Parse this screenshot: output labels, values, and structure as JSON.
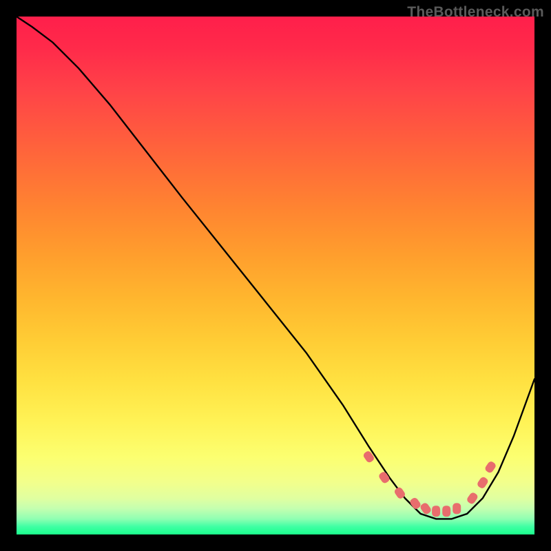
{
  "watermark": "TheBottleneck.com",
  "chart_data": {
    "type": "line",
    "title": "",
    "xlabel": "",
    "ylabel": "",
    "xlim": [
      0,
      100
    ],
    "ylim": [
      0,
      100
    ],
    "series": [
      {
        "name": "bottleneck-curve",
        "x": [
          0,
          3,
          7,
          12,
          18,
          25,
          32,
          40,
          48,
          56,
          63,
          68,
          72,
          75,
          78,
          81,
          84,
          87,
          90,
          93,
          96,
          100
        ],
        "y": [
          100,
          98,
          95,
          90,
          83,
          74,
          65,
          55,
          45,
          35,
          25,
          17,
          11,
          7,
          4,
          3,
          3,
          4,
          7,
          12,
          19,
          30
        ]
      }
    ],
    "markers": {
      "name": "bottleneck-dots",
      "points": [
        {
          "x": 68,
          "y": 15
        },
        {
          "x": 71,
          "y": 11
        },
        {
          "x": 74,
          "y": 8
        },
        {
          "x": 77,
          "y": 6
        },
        {
          "x": 79,
          "y": 5
        },
        {
          "x": 81,
          "y": 4.5
        },
        {
          "x": 83,
          "y": 4.5
        },
        {
          "x": 85,
          "y": 5
        },
        {
          "x": 88,
          "y": 7
        },
        {
          "x": 90,
          "y": 10
        },
        {
          "x": 91.5,
          "y": 13
        }
      ]
    },
    "colors": {
      "curve": "#000000",
      "markers": "#e86d6d",
      "gradient_top": "#ff1f4b",
      "gradient_bottom": "#1bff8c"
    }
  }
}
